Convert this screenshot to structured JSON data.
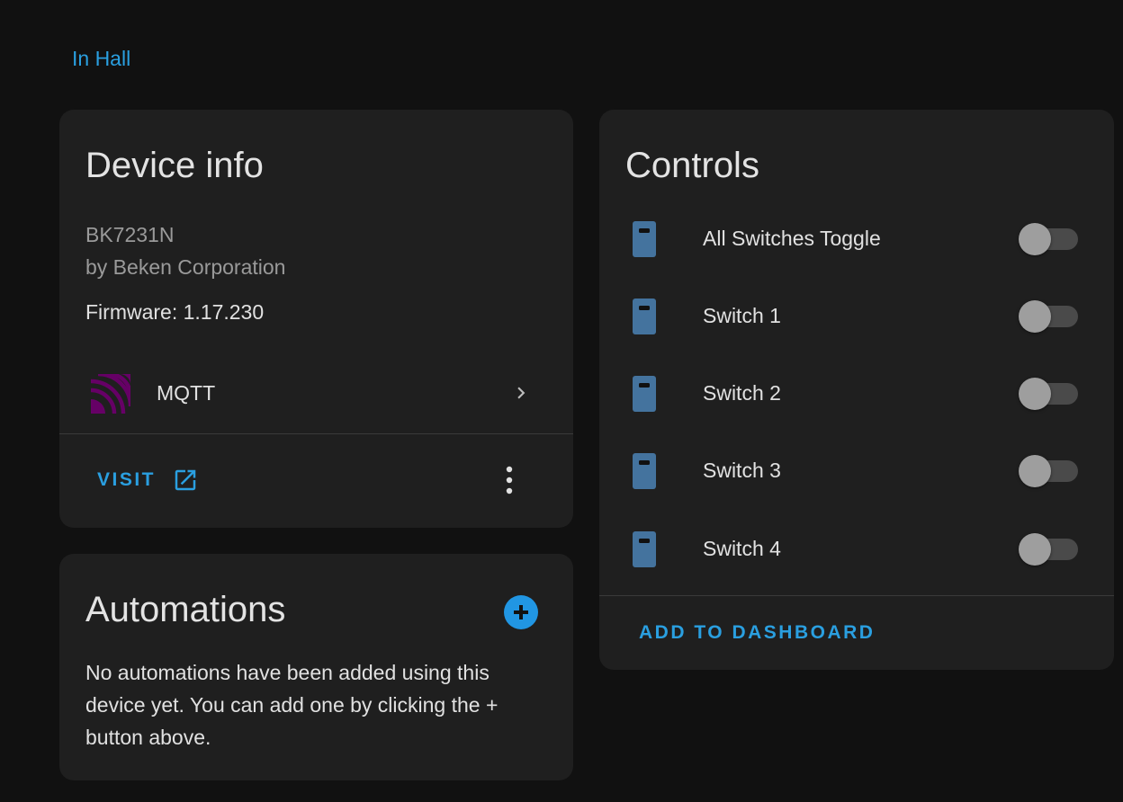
{
  "breadcrumb": {
    "area": "In Hall"
  },
  "device_info": {
    "title": "Device info",
    "model": "BK7231N",
    "manufacturer": "by Beken Corporation",
    "firmware": "Firmware: 1.17.230",
    "integration": {
      "name": "MQTT",
      "icon": "mqtt-logo",
      "color": "#660066"
    },
    "visit_label": "VISIT",
    "visit_icon": "open-in-new-icon",
    "overflow_icon": "dots-vertical-icon"
  },
  "automations": {
    "title": "Automations",
    "add_icon": "plus-circle-icon",
    "empty_text": "No automations have been added using this device yet. You can add one by clicking the + button above."
  },
  "controls": {
    "title": "Controls",
    "items": [
      {
        "label": "All Switches Toggle",
        "icon": "light-switch-icon",
        "state": "off"
      },
      {
        "label": "Switch 1",
        "icon": "light-switch-icon",
        "state": "off"
      },
      {
        "label": "Switch 2",
        "icon": "light-switch-icon",
        "state": "off"
      },
      {
        "label": "Switch 3",
        "icon": "light-switch-icon",
        "state": "off"
      },
      {
        "label": "Switch 4",
        "icon": "light-switch-icon",
        "state": "off"
      }
    ],
    "add_to_dashboard_label": "ADD TO DASHBOARD"
  },
  "colors": {
    "background": "#111111",
    "card": "#1f1f1f",
    "accent": "#2a9fe0",
    "switch_icon": "#44739e"
  }
}
